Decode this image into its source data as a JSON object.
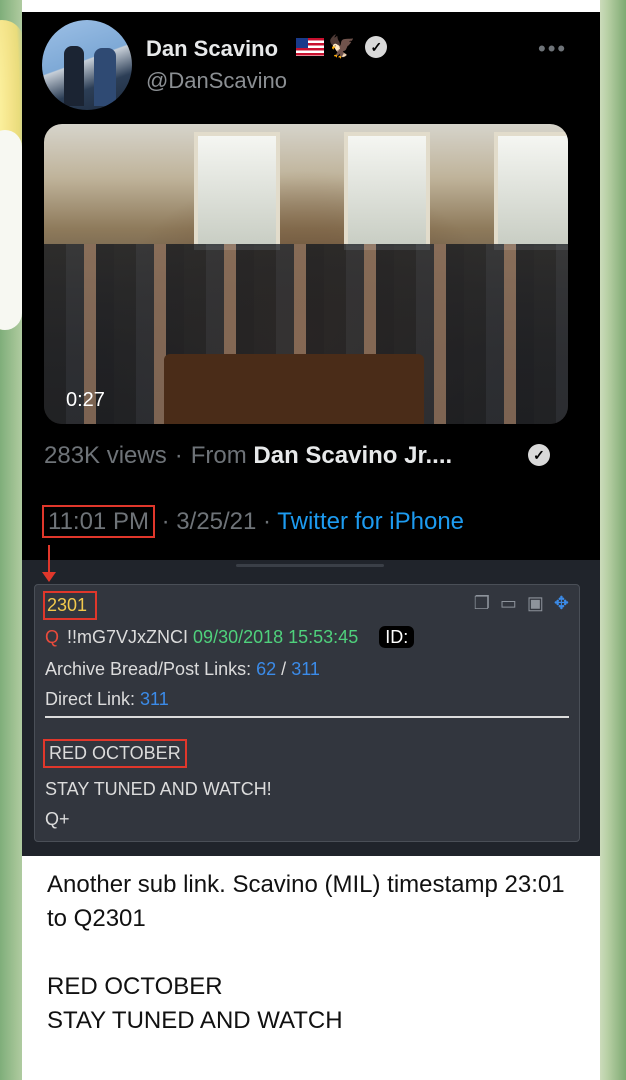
{
  "tweet": {
    "name": "Dan Scavino",
    "handle": "@DanScavino",
    "video_duration": "0:27",
    "views": "283K views",
    "dot": "·",
    "from_label": "From",
    "from_name": "Dan Scavino Jr....",
    "time": "11:01 PM",
    "date": "3/25/21",
    "client": "Twitter for iPhone"
  },
  "qpost": {
    "number": "2301",
    "q_label": "Q",
    "tripcode": "!!mG7VJxZNCI",
    "datetime": "09/30/2018 15:53:45",
    "id_label": "ID:",
    "archive_label": "Archive Bread/Post Links:",
    "archive_bread": "62",
    "archive_slash": "/",
    "archive_post": "311",
    "direct_label": "Direct Link:",
    "direct_link": "311",
    "line1": "RED OCTOBER",
    "line2": "STAY TUNED AND WATCH!",
    "line3": "Q+"
  },
  "caption": {
    "p1": "Another sub link. Scavino (MIL) timestamp 23:01 to Q2301",
    "p2": "RED OCTOBER",
    "p3": "STAY TUNED AND WATCH"
  },
  "colors": {
    "twitter_blue": "#1d9bf0",
    "highlight_red": "#e0372b",
    "q_number_yellow": "#f2c94c",
    "q_date_green": "#4fd17c"
  }
}
